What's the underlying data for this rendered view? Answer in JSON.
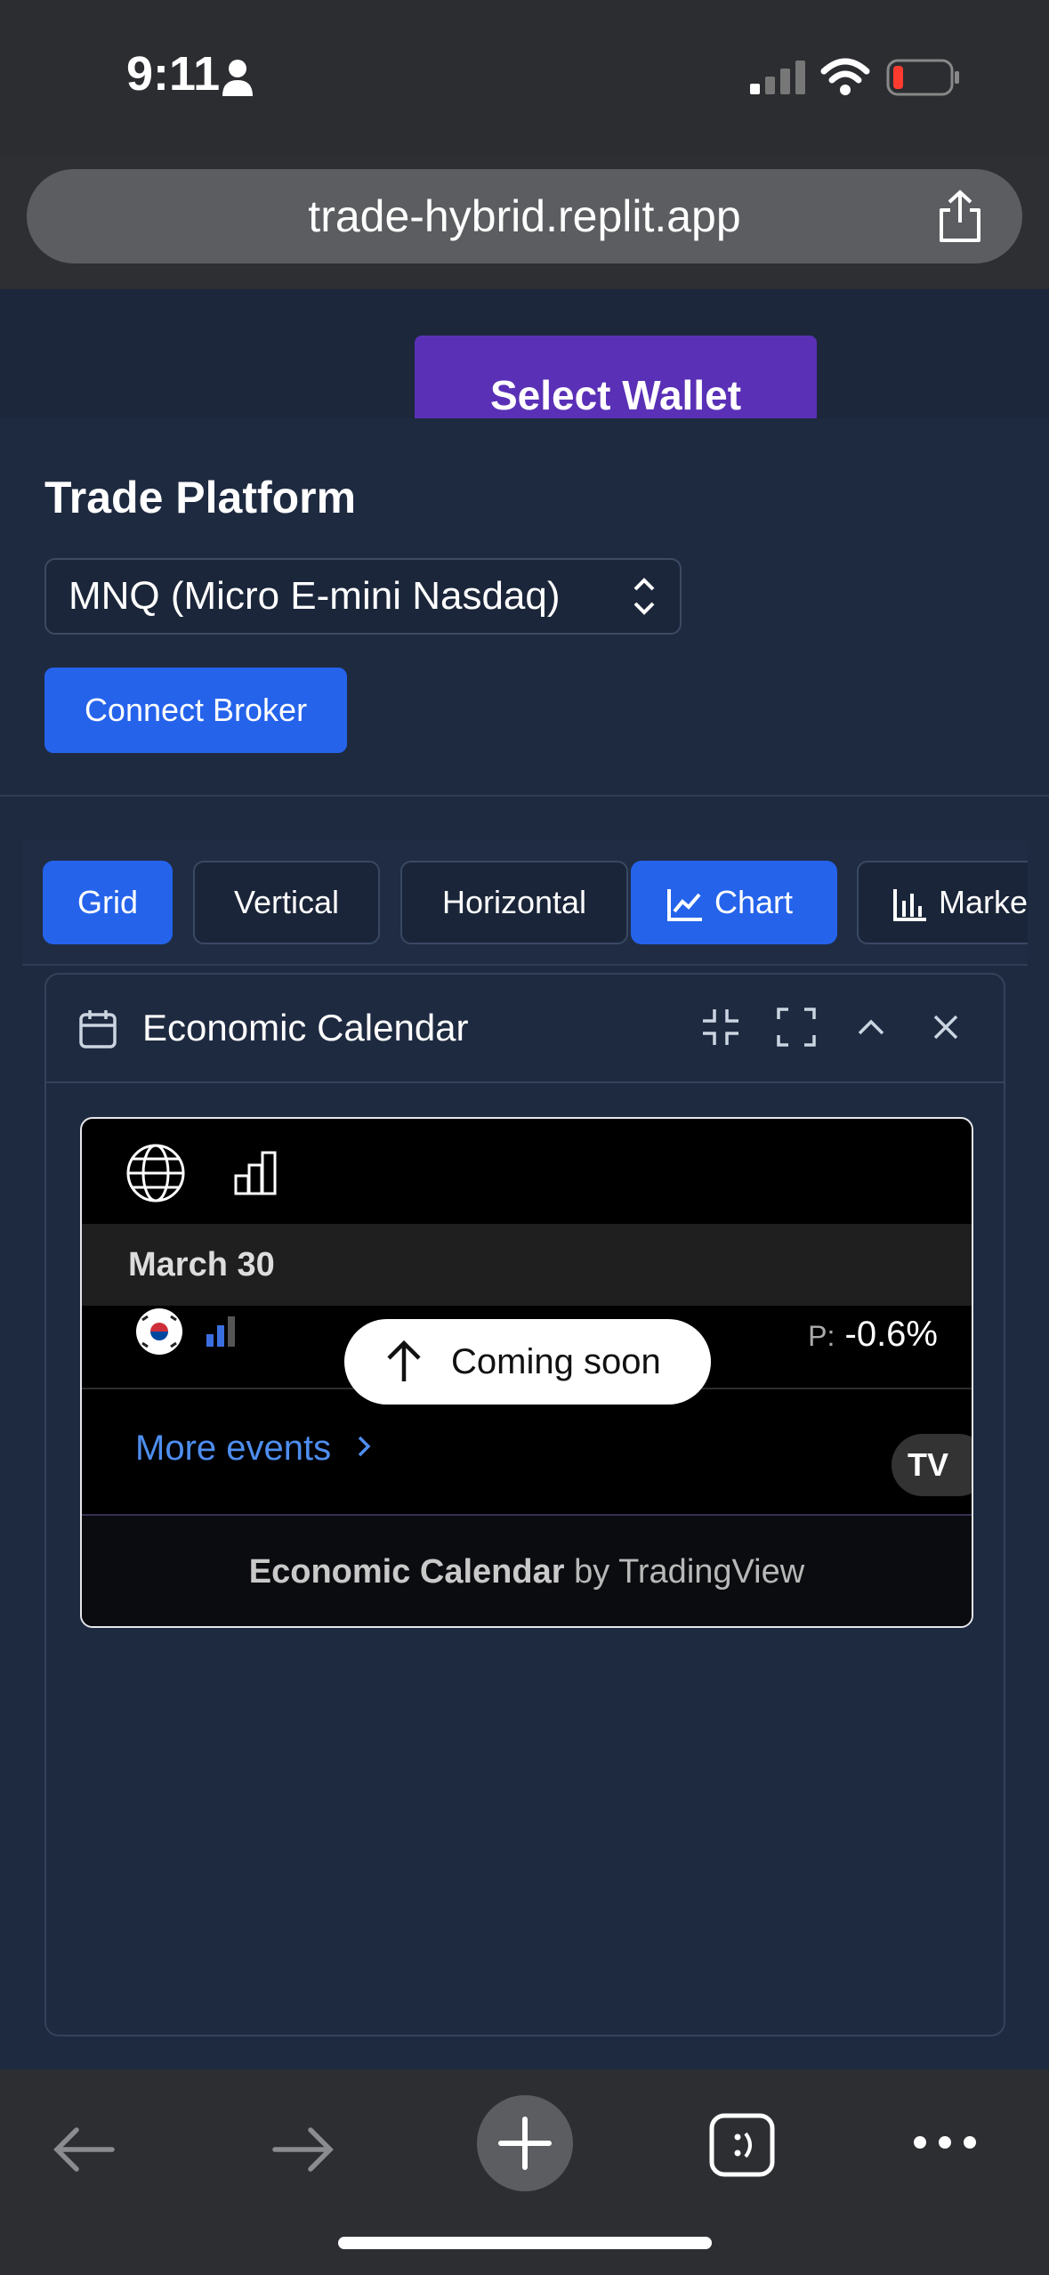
{
  "status_bar": {
    "time": "9:11"
  },
  "browser": {
    "url": "trade-hybrid.replit.app"
  },
  "wallet": {
    "button_label": "Select Wallet"
  },
  "trade_panel": {
    "title": "Trade Platform",
    "instrument_selected": "MNQ (Micro E-mini Nasdaq)",
    "connect_label": "Connect Broker"
  },
  "layout_tabs": [
    {
      "label": "Grid",
      "active": true
    },
    {
      "label": "Vertical",
      "active": false
    },
    {
      "label": "Horizontal",
      "active": false
    },
    {
      "label": "Chart",
      "active": true
    },
    {
      "label": "Market",
      "active": false
    }
  ],
  "calendar": {
    "title": "Economic Calendar",
    "date": "March 30",
    "value_prefix": "P:",
    "value": "-0.6%",
    "coming_soon": "Coming soon",
    "more_events": "More events",
    "footer_bold": "Economic Calendar",
    "footer_rest": " by TradingView",
    "tv_logo": "TV"
  },
  "colors": {
    "accent": "#2563eb",
    "wallet": "#5a30b6",
    "panel": "#1e2a40"
  }
}
